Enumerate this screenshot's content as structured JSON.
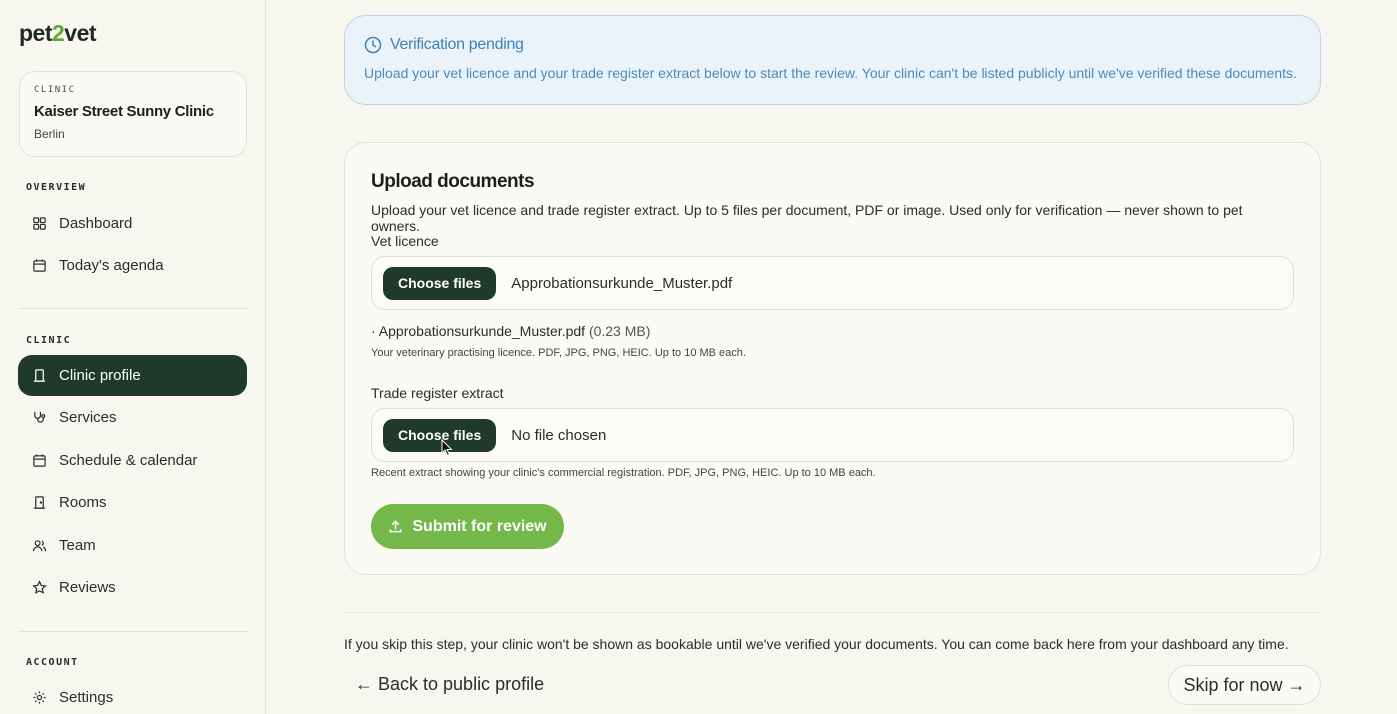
{
  "brand": {
    "logo_part1": "pet",
    "logo_part2": "2",
    "logo_part3": "vet"
  },
  "clinic_card": {
    "tag": "CLINIC",
    "name": "Kaiser Street Sunny Clinic",
    "city": "Berlin"
  },
  "sidebar": {
    "overview_label": "OVERVIEW",
    "overview_items": [
      {
        "label": "Dashboard",
        "icon": "grid-icon"
      },
      {
        "label": "Today's agenda",
        "icon": "calendar-icon"
      }
    ],
    "clinic_label": "CLINIC",
    "clinic_items": [
      {
        "label": "Clinic profile",
        "icon": "building-icon",
        "active": true
      },
      {
        "label": "Services",
        "icon": "stethoscope-icon"
      },
      {
        "label": "Schedule & calendar",
        "icon": "calendar-icon"
      },
      {
        "label": "Rooms",
        "icon": "door-icon"
      },
      {
        "label": "Team",
        "icon": "users-icon"
      },
      {
        "label": "Reviews",
        "icon": "star-icon"
      }
    ],
    "account_label": "ACCOUNT",
    "account_items": [
      {
        "label": "Settings",
        "icon": "gear-icon"
      }
    ]
  },
  "banner": {
    "title": "Verification pending",
    "text": "Upload your vet licence and your trade register extract below to start the review. Your clinic can't be listed publicly until we've verified these documents."
  },
  "upload": {
    "title": "Upload documents",
    "description": "Upload your vet licence and trade register extract. Up to 5 files per document, PDF or image. Used only for verification — never shown to pet owners.",
    "vet_licence": {
      "label": "Vet licence",
      "button": "Choose files",
      "chosen": "Approbationsurkunde_Muster.pdf",
      "entry_bullet": "·",
      "entry_name": "Approbationsurkunde_Muster.pdf",
      "entry_size": "(0.23 MB)",
      "hint": "Your veterinary practising licence. PDF, JPG, PNG, HEIC. Up to 10 MB each."
    },
    "trade_register": {
      "label": "Trade register extract",
      "button": "Choose files",
      "chosen": "No file chosen",
      "hint": "Recent extract showing your clinic's commercial registration. PDF, JPG, PNG, HEIC. Up to 10 MB each."
    },
    "submit_label": "Submit for review"
  },
  "footer": {
    "skip_note": "If you skip this step, your clinic won't be shown as bookable until we've verified your documents. You can come back here from your dashboard any time.",
    "back_label": "← Back to public profile",
    "skip_label": "Skip for now →"
  },
  "colors": {
    "accent_dark": "#1f3a2b",
    "accent_green": "#74b84a",
    "info_blue": "#3f82b5",
    "background": "#f7f6ef"
  }
}
